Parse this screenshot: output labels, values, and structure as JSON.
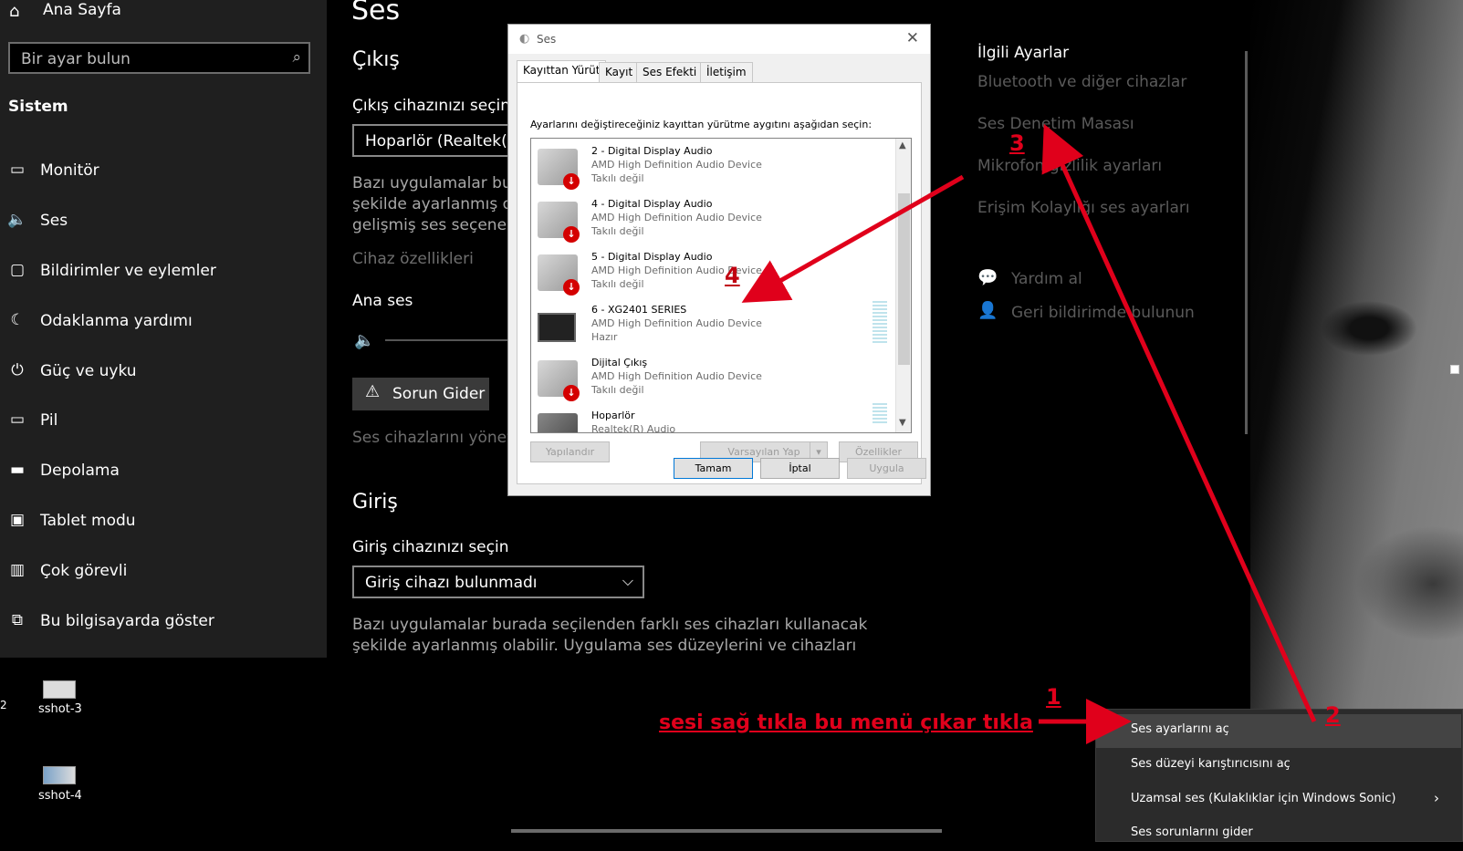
{
  "sidebar": {
    "home": {
      "label": "Ana Sayfa",
      "icon": "home-icon"
    },
    "search": {
      "placeholder": "Bir ayar bulun",
      "icon": "search-icon"
    },
    "section": "Sistem",
    "items": [
      {
        "label": "Monitör",
        "icon": "monitor-icon"
      },
      {
        "label": "Ses",
        "icon": "speaker-icon"
      },
      {
        "label": "Bildirimler ve eylemler",
        "icon": "notification-icon"
      },
      {
        "label": "Odaklanma yardımı",
        "icon": "moon-icon"
      },
      {
        "label": "Güç ve uyku",
        "icon": "power-icon"
      },
      {
        "label": "Pil",
        "icon": "battery-icon"
      },
      {
        "label": "Depolama",
        "icon": "storage-icon"
      },
      {
        "label": "Tablet modu",
        "icon": "tablet-icon"
      },
      {
        "label": "Çok görevli",
        "icon": "multitask-icon"
      },
      {
        "label": "Bu bilgisayarda göster",
        "icon": "project-icon"
      }
    ]
  },
  "main": {
    "title": "Ses",
    "output": {
      "heading": "Çıkış",
      "select_label": "Çıkış cihazınızı seçin",
      "selected": "Hoparlör (Realtek(R)",
      "desc_lines": [
        "Bazı uygulamalar bura",
        "şekilde ayarlanmış ola",
        "gelişmiş ses seçenekle"
      ],
      "device_props": "Cihaz özellikleri",
      "master_volume": "Ana ses",
      "troubleshoot": "Sorun Gider",
      "manage_devices": "Ses cihazlarını yönet"
    },
    "input": {
      "heading": "Giriş",
      "select_label": "Giriş cihazınızı seçin",
      "selected": "Giriş cihazı bulunmadı",
      "desc_lines": [
        "Bazı uygulamalar burada seçilenden farklı ses cihazları kullanacak",
        "şekilde ayarlanmış olabilir. Uygulama ses düzeylerini ve cihazları"
      ]
    },
    "related": {
      "title": "İlgili Ayarlar",
      "links": [
        "Bluetooth ve diğer cihazlar",
        "Ses Denetim Masası",
        "Mikrofon gizlilik ayarları",
        "Erişim Kolaylığı ses ayarları"
      ],
      "help": "Yardım al",
      "feedback": "Geri bildirimde bulunun"
    }
  },
  "dialog": {
    "title": "Ses",
    "tabs": [
      "Kayıttan Yürüt",
      "Kayıt",
      "Ses Efekti",
      "İletişim"
    ],
    "instruction": "Ayarlarını değiştireceğiniz kayıttan yürütme aygıtını aşağıdan seçin:",
    "devices": [
      {
        "name": "2 - Digital Display Audio",
        "driver": "AMD High Definition Audio Device",
        "status": "Takılı değil"
      },
      {
        "name": "4 - Digital Display Audio",
        "driver": "AMD High Definition Audio Device",
        "status": "Takılı değil"
      },
      {
        "name": "5 - Digital Display Audio",
        "driver": "AMD High Definition Audio Device",
        "status": "Takılı değil"
      },
      {
        "name": "6 - XG2401 SERIES",
        "driver": "AMD High Definition Audio Device",
        "status": "Hazır"
      },
      {
        "name": "Dijital Çıkış",
        "driver": "AMD High Definition Audio Device",
        "status": "Takılı değil"
      },
      {
        "name": "Hoparlör",
        "driver": "Realtek(R) Audio",
        "status": ""
      }
    ],
    "buttons": {
      "configure": "Yapılandır",
      "set_default": "Varsayılan Yap",
      "properties": "Özellikler",
      "ok": "Tamam",
      "cancel": "İptal",
      "apply": "Uygula"
    }
  },
  "desktop": {
    "icons": [
      "sshot-3",
      "sshot-4"
    ],
    "stray_char": "2"
  },
  "context_menu": {
    "items": [
      "Ses ayarlarını aç",
      "Ses düzeyi karıştırıcısını aç",
      "Uzamsal ses (Kulaklıklar için Windows Sonic)",
      "Ses sorunlarını gider"
    ]
  },
  "annotations": {
    "instruction": "sesi sağ tıkla bu menü çıkar tıkla",
    "markers": [
      "1",
      "2",
      "3",
      "4"
    ],
    "color": "#e0001b"
  }
}
